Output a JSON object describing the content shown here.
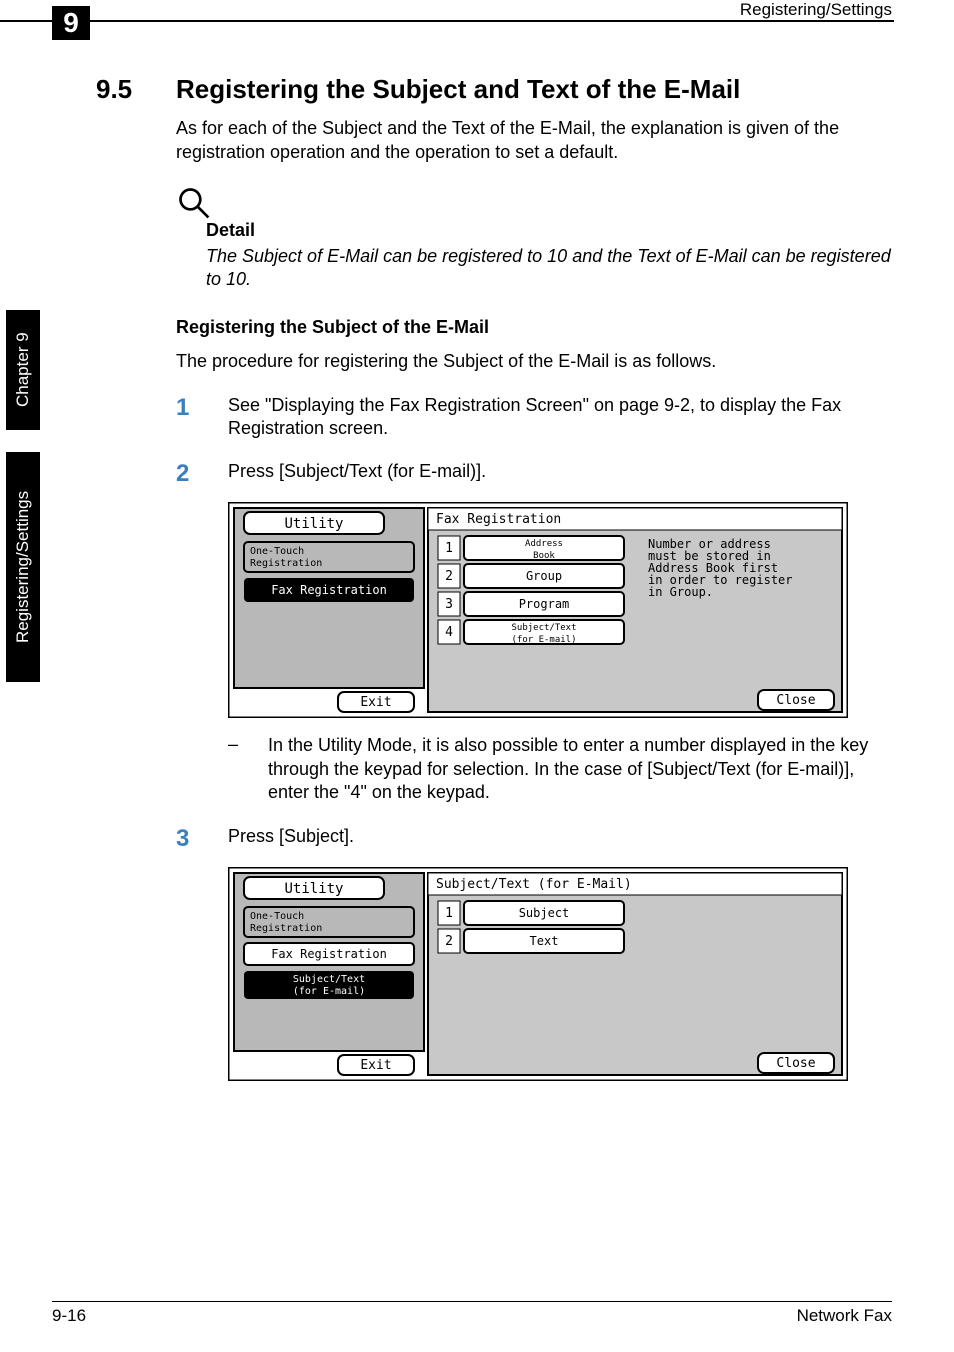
{
  "header": {
    "chapter_tab": "9",
    "running_title": "Registering/Settings"
  },
  "sidebar": {
    "chapter_label": "Chapter 9",
    "section_label": "Registering/Settings"
  },
  "section": {
    "number": "9.5",
    "title": "Registering the Subject and Text of the E-Mail",
    "intro": "As for each of the Subject and the Text of the E-Mail, the explanation is given of the registration operation and the operation to set a default."
  },
  "detail": {
    "heading": "Detail",
    "body": "The Subject of E-Mail can be registered to 10 and the Text of E-Mail can be registered to 10."
  },
  "subheading": "Registering the Subject of the E-Mail",
  "sub_intro": "The procedure for registering the Subject of the E-Mail is as follows.",
  "steps": {
    "s1_num": "1",
    "s1_text": "See \"Displaying the Fax Registration Screen\" on page 9-2, to display the Fax Registration screen.",
    "s2_num": "2",
    "s2_text": "Press [Subject/Text (for E-mail)].",
    "s3_num": "3",
    "s3_text": "Press [Subject]."
  },
  "screenshot1": {
    "utility": "Utility",
    "nav1": "One-Touch\nRegistration",
    "nav2": "Fax Registration",
    "panel_title": "Fax Registration",
    "b1_num": "1",
    "b1_label": "Address\nBook",
    "b2_num": "2",
    "b2_label": "Group",
    "b3_num": "3",
    "b3_label": "Program",
    "b4_num": "4",
    "b4_label": "Subject/Text\n(for E-mail)",
    "hint": "Number or address\nmust be stored in\nAddress Book first\nin order to register\nin Group.",
    "exit": "Exit",
    "close": "Close"
  },
  "bullet_text": "In the Utility Mode, it is also possible to enter a number displayed in the key through the keypad for selection. In the case of [Subject/Text (for E-mail)], enter the \"4\" on the keypad.",
  "screenshot2": {
    "utility": "Utility",
    "nav1": "One-Touch\nRegistration",
    "nav2": "Fax Registration",
    "nav3": "Subject/Text\n(for E-mail)",
    "panel_title": "Subject/Text (for E-Mail)",
    "b1_num": "1",
    "b1_label": "Subject",
    "b2_num": "2",
    "b2_label": "Text",
    "exit": "Exit",
    "close": "Close"
  },
  "footer": {
    "page": "9-16",
    "doc": "Network Fax"
  }
}
